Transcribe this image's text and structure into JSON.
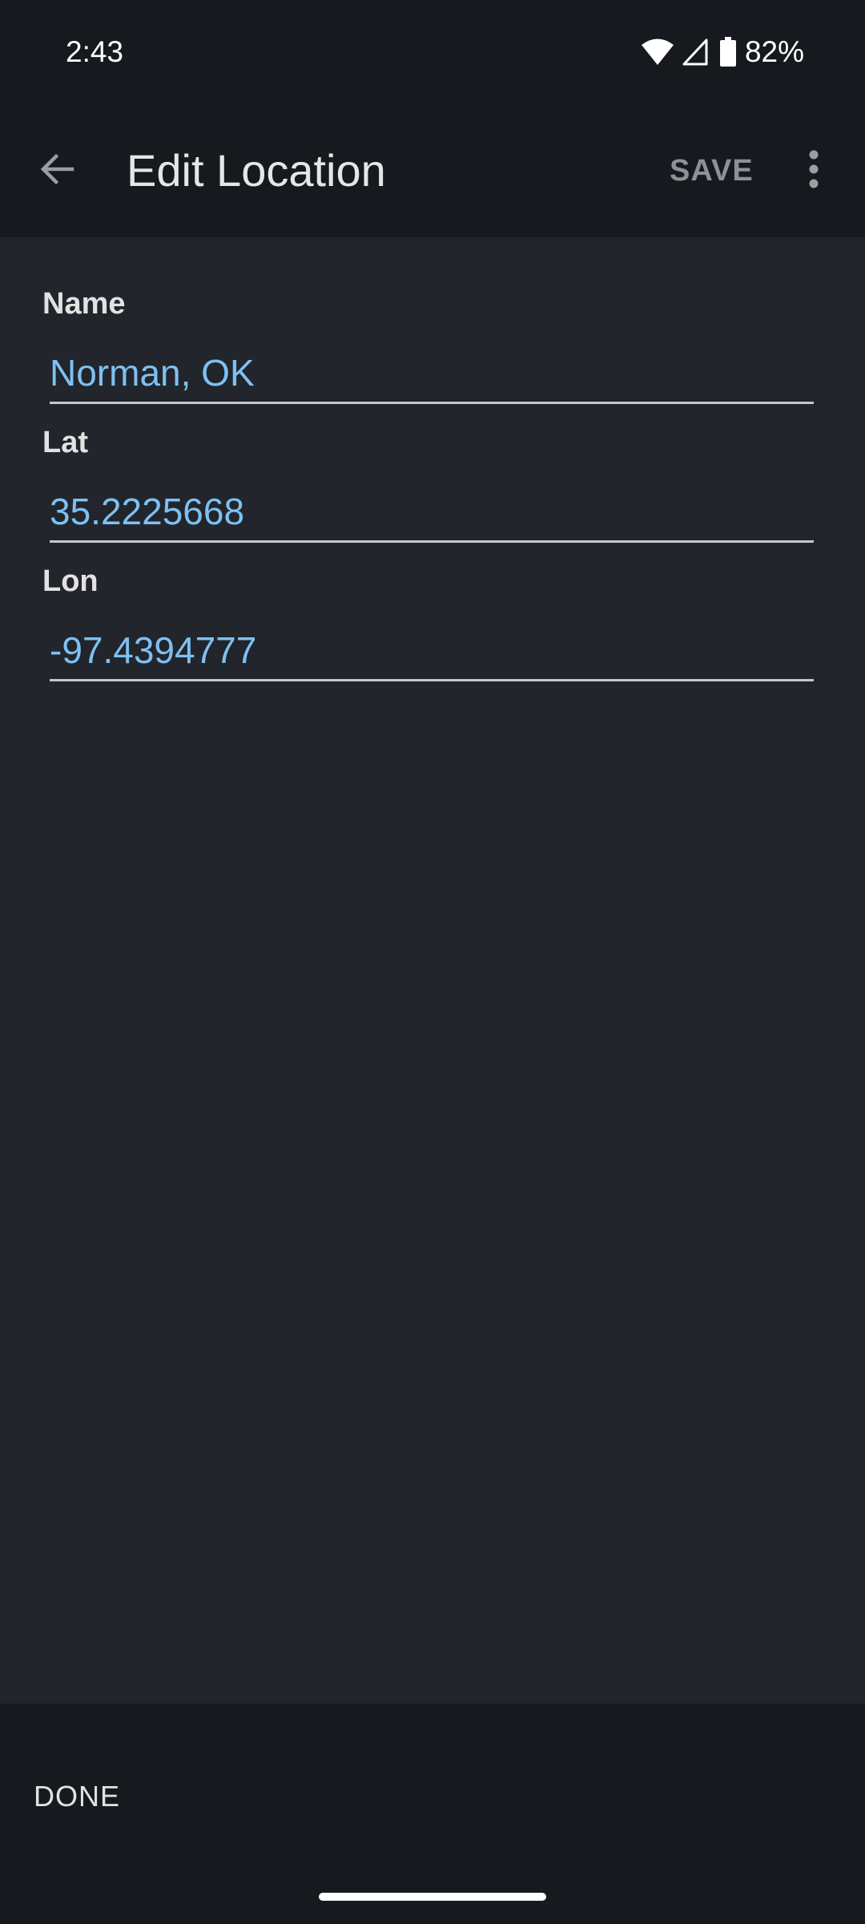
{
  "status_bar": {
    "time": "2:43",
    "battery_percent": "82%",
    "icons": [
      "wifi-icon",
      "cell-signal-icon",
      "battery-icon"
    ]
  },
  "toolbar": {
    "title": "Edit Location",
    "save_label": "SAVE",
    "back_icon": "arrow-back-icon",
    "more_icon": "more-vert-icon"
  },
  "form": {
    "name": {
      "label": "Name",
      "value": "Norman, OK"
    },
    "lat": {
      "label": "Lat",
      "value": "35.2225668"
    },
    "lon": {
      "label": "Lon",
      "value": "-97.4394777"
    }
  },
  "bottom_bar": {
    "done_label": "DONE"
  },
  "colors": {
    "background": "#22252b",
    "bar_background": "#161a1e",
    "input_text": "#7ec0f2",
    "label_text": "#e2e2e2",
    "muted_action": "#8d9095"
  }
}
